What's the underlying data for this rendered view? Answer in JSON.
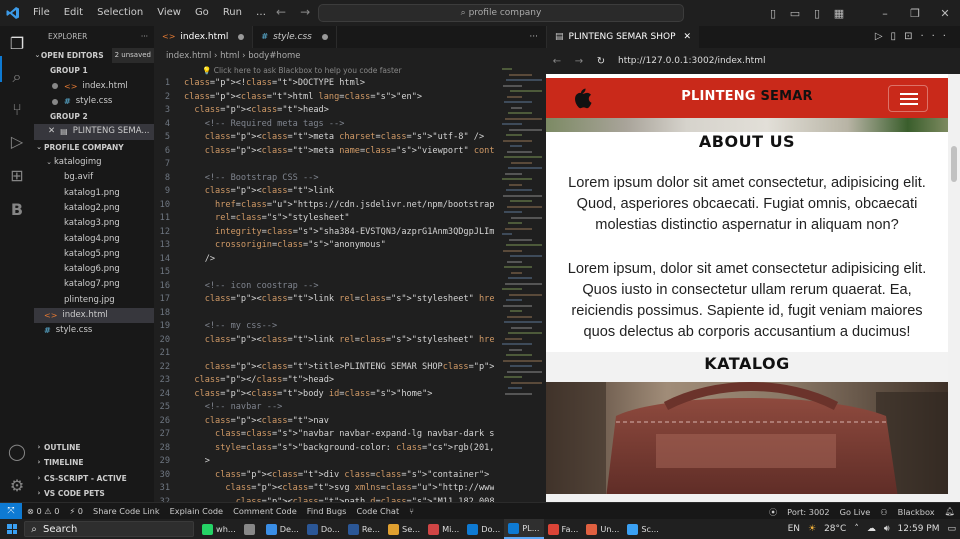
{
  "titlebar": {
    "menu": [
      "File",
      "Edit",
      "Selection",
      "View",
      "Go",
      "Run",
      "…"
    ],
    "search": "profile company",
    "logo": "vscode-logo"
  },
  "activity_icons": [
    "explorer-icon",
    "search-icon",
    "source-control-icon",
    "run-debug-icon",
    "extensions-icon",
    "blackbox-icon",
    "account-icon",
    "settings-gear-icon"
  ],
  "sidebar": {
    "title": "EXPLORER",
    "open_editors": {
      "label": "OPEN EDITORS",
      "badge": "2 unsaved"
    },
    "group1": {
      "label": "GROUP 1",
      "files": [
        "index.html",
        "style.css"
      ]
    },
    "group2": {
      "label": "GROUP 2",
      "files": [
        "PLINTENG SEMA..."
      ]
    },
    "project": {
      "label": "PROFILE COMPANY",
      "folder": "katalogimg",
      "folder_files": [
        "bg.avif",
        "katalog1.png",
        "katalog2.png",
        "katalog3.png",
        "katalog4.png",
        "katalog5.png",
        "katalog6.png",
        "katalog7.png",
        "plinteng.jpg"
      ],
      "root_files": [
        "index.html",
        "style.css"
      ]
    },
    "bottom_sections": [
      "OUTLINE",
      "TIMELINE",
      "CS-SCRIPT - ACTIVE",
      "VS CODE PETS"
    ]
  },
  "editor": {
    "tabs": [
      "index.html",
      "style.css"
    ],
    "breadcrumb": "index.html › html › body#home",
    "hint": "Click here to ask Blackbox to help you code faster",
    "lines": [
      {
        "n": "1",
        "code": "<!DOCTYPE html>"
      },
      {
        "n": "2",
        "code": "<html lang=\"en\">"
      },
      {
        "n": "3",
        "code": "  <head>"
      },
      {
        "n": "4",
        "code": "    <!-- Required meta tags -->"
      },
      {
        "n": "5",
        "code": "    <meta charset=\"utf-8\" />"
      },
      {
        "n": "6",
        "code": "    <meta name=\"viewport\" content=\"width=device-width,"
      },
      {
        "n": "7",
        "code": ""
      },
      {
        "n": "8",
        "code": "    <!-- Bootstrap CSS -->"
      },
      {
        "n": "9",
        "code": "    <link"
      },
      {
        "n": "10",
        "code": "      href=\"https://cdn.jsdelivr.net/npm/bootstrap@5.0"
      },
      {
        "n": "11",
        "code": "      rel=\"stylesheet\""
      },
      {
        "n": "12",
        "code": "      integrity=\"sha384-EVSTQN3/azprG1Anm3QDgpJLIm9Nao"
      },
      {
        "n": "13",
        "code": "      crossorigin=\"anonymous\""
      },
      {
        "n": "14",
        "code": "    />"
      },
      {
        "n": "15",
        "code": ""
      },
      {
        "n": "16",
        "code": "    <!-- icon coostrap -->"
      },
      {
        "n": "17",
        "code": "    <link rel=\"stylesheet\" href=\"https://cdn.jsdelivr."
      },
      {
        "n": "18",
        "code": ""
      },
      {
        "n": "19",
        "code": "    <!-- my css-->"
      },
      {
        "n": "20",
        "code": "    <link rel=\"stylesheet\" href=\"style.css\" />"
      },
      {
        "n": "21",
        "code": ""
      },
      {
        "n": "22",
        "code": "    <title>PLINTENG SEMAR SHOP</title>"
      },
      {
        "n": "23",
        "code": "  </head>"
      },
      {
        "n": "24",
        "code": "  <body id=\"home\">"
      },
      {
        "n": "25",
        "code": "    <!-- navbar -->"
      },
      {
        "n": "26",
        "code": "    <nav"
      },
      {
        "n": "27",
        "code": "      class=\"navbar navbar-expand-lg navbar-dark shado"
      },
      {
        "n": "28",
        "code": "      style=\"background-color: ■rgb(201, 41, 19)\""
      },
      {
        "n": "29",
        "code": "    >"
      },
      {
        "n": "30",
        "code": "      <div class=\"container\">"
      },
      {
        "n": "31",
        "code": "        <svg xmlns=\"http://www.w3.org/2000/svg\" width="
      },
      {
        "n": "32",
        "code": "          <path d=\"M11.182.008C11.148-.03 9.923.023 8."
      }
    ]
  },
  "preview": {
    "tab": "PLINTENG SEMAR SHOP",
    "url": "http://127.0.0.1:3002/index.html",
    "brand_a": "PLINTENG",
    "brand_b": "SEMAR",
    "about_title": "ABOUT US",
    "about_p1": "Lorem ipsum dolor sit amet consectetur, adipisicing elit. Quod, asperiores obcaecati. Fugiat omnis, obcaecati molestias distinctio aspernatur in aliquam non?",
    "about_p2": "Lorem ipsum, dolor sit amet consectetur adipisicing elit. Quos iusto in consectetur ullam rerum quaerat. Ea, reiciendis possimus. Sapiente id, fugit veniam maiores quos delectus ab corporis accusantium a ducimus!",
    "katalog_title": "KATALOG",
    "nav_color": "#c9291a"
  },
  "statusbar": {
    "left": [
      "⊗ 0 ⚠ 0",
      "⚡ 0",
      "Share Code Link",
      "Explain Code",
      "Comment Code",
      "Find Bugs",
      "Code Chat"
    ],
    "right": [
      "Port: 3002",
      "Go Live",
      "Blackbox"
    ]
  },
  "taskbar": {
    "search": "Search",
    "apps": [
      {
        "label": "wh...",
        "color": "#25d366"
      },
      {
        "label": "",
        "color": "#888888"
      },
      {
        "label": "De...",
        "color": "#3a8ee6"
      },
      {
        "label": "Do...",
        "color": "#2b5797"
      },
      {
        "label": "Re...",
        "color": "#2b5797"
      },
      {
        "label": "Se...",
        "color": "#e0a030"
      },
      {
        "label": "Mi...",
        "color": "#d04545"
      },
      {
        "label": "Do...",
        "color": "#0e7ad3"
      },
      {
        "label": "PL...",
        "color": "#0e7ad3"
      },
      {
        "label": "Fa...",
        "color": "#db4437"
      },
      {
        "label": "Un...",
        "color": "#e06040"
      },
      {
        "label": "Sc...",
        "color": "#3aa0f3"
      }
    ],
    "lang": "EN",
    "weather": "28°C",
    "time": "12:59 PM"
  }
}
